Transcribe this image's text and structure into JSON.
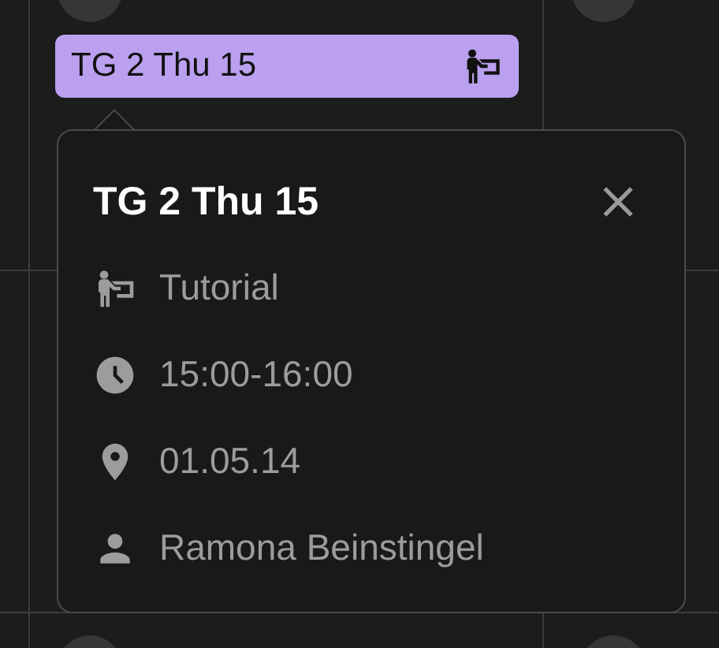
{
  "event": {
    "title": "TG 2 Thu 15",
    "kind": "tutorial",
    "color": "#bba0ef"
  },
  "popover": {
    "title": "TG 2 Thu 15",
    "open": true,
    "details": [
      {
        "kind": "type",
        "text": "Tutorial"
      },
      {
        "kind": "time",
        "text": "15:00-16:00"
      },
      {
        "kind": "location",
        "text": "01.05.14"
      },
      {
        "kind": "person",
        "text": "Ramona Beinstingel"
      }
    ]
  }
}
